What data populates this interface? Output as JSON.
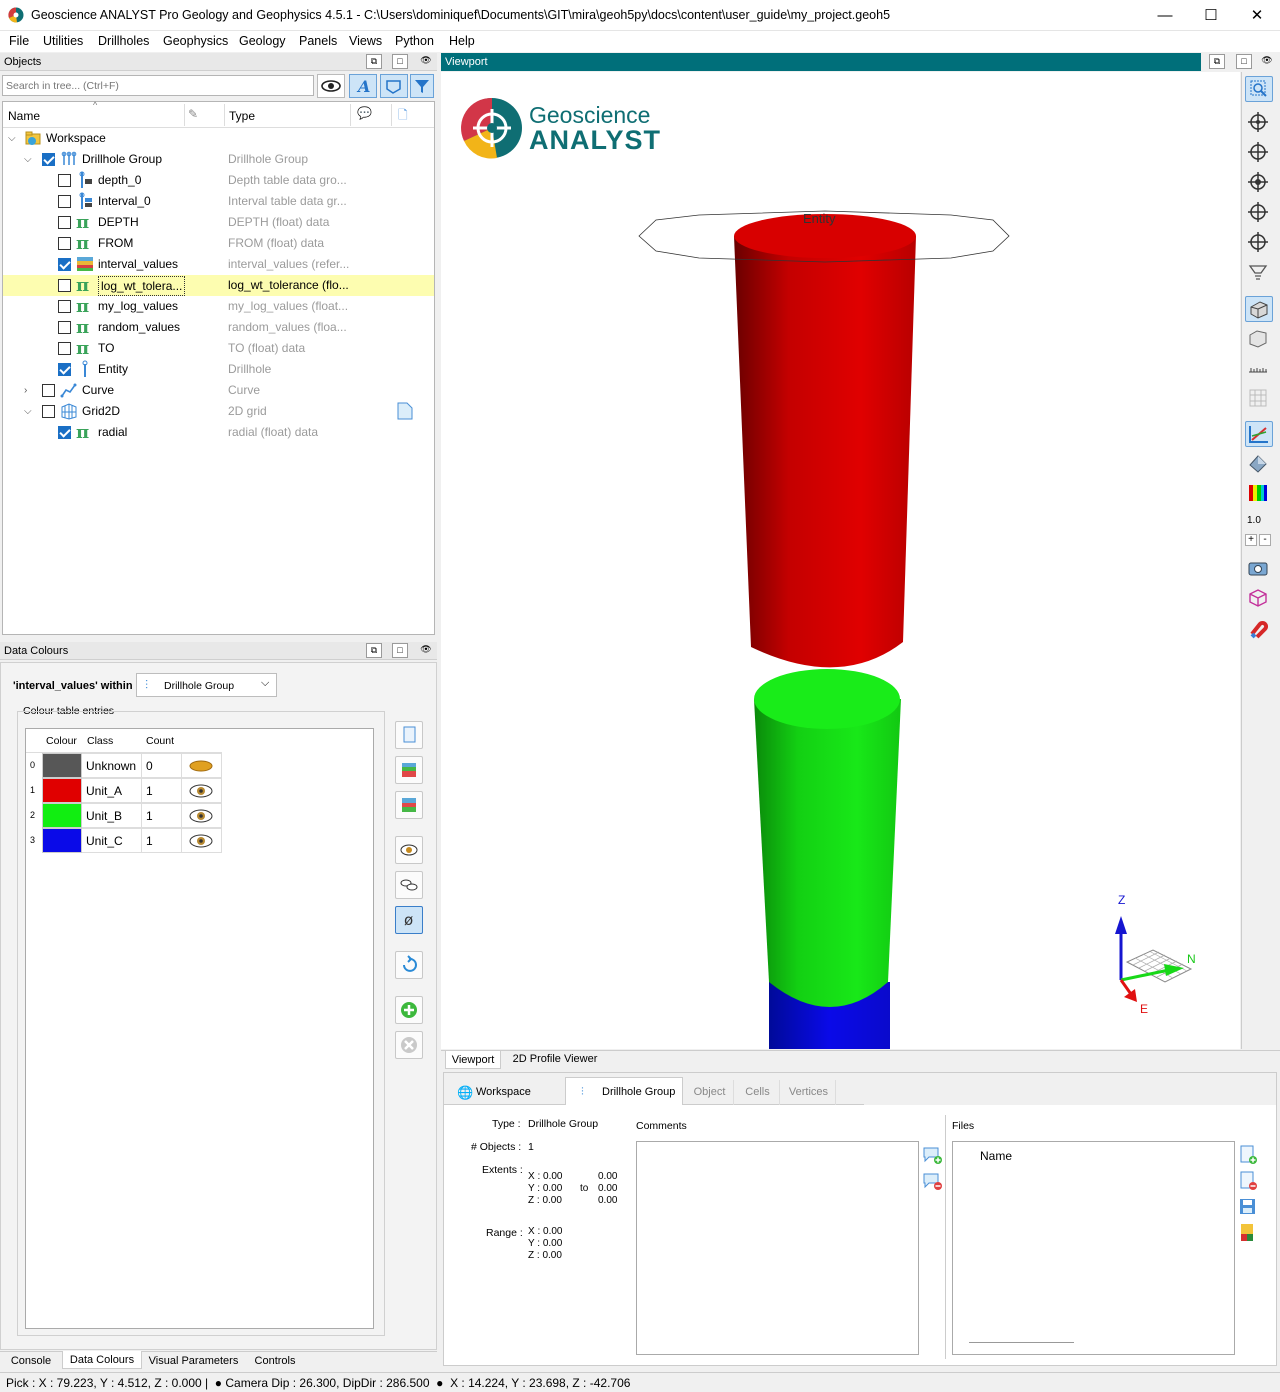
{
  "window": {
    "title": "Geoscience ANALYST Pro Geology and Geophysics 4.5.1 - C:\\Users\\dominiquef\\Documents\\GIT\\mira\\geoh5py\\docs\\content\\user_guide\\my_project.geoh5",
    "minimize": "—",
    "maximize": "☐",
    "close": "✕"
  },
  "menu": [
    "File",
    "Utilities",
    "Drillholes",
    "Geophysics",
    "Geology",
    "Panels",
    "Views",
    "Python",
    "Help"
  ],
  "objects_panel": {
    "title": "Objects",
    "search_placeholder": "Search in tree... (Ctrl+F)",
    "col_name": "Name",
    "col_type": "Type"
  },
  "tree": [
    {
      "label": "Workspace",
      "type": "",
      "level": 0,
      "expand": "open",
      "checkbox": "none",
      "icon": "workspace"
    },
    {
      "label": "Drillhole Group",
      "type": "Drillhole Group",
      "level": 1,
      "expand": "open",
      "checkbox": "on",
      "icon": "drillgroup"
    },
    {
      "label": "depth_0",
      "type": "Depth table data gro...",
      "level": 2,
      "expand": "",
      "checkbox": "off",
      "icon": "depthtable"
    },
    {
      "label": "Interval_0",
      "type": "Interval table data gr...",
      "level": 2,
      "expand": "",
      "checkbox": "off",
      "icon": "intervaltable"
    },
    {
      "label": "DEPTH",
      "type": "DEPTH (float) data",
      "level": 2,
      "expand": "",
      "checkbox": "off",
      "icon": "pi"
    },
    {
      "label": "FROM",
      "type": "FROM (float) data",
      "level": 2,
      "expand": "",
      "checkbox": "off",
      "icon": "pi"
    },
    {
      "label": "interval_values",
      "type": "interval_values (refer...",
      "level": 2,
      "expand": "",
      "checkbox": "on",
      "icon": "ref"
    },
    {
      "label": "log_wt_tolera...",
      "type": "log_wt_tolerance (flo...",
      "level": 2,
      "expand": "",
      "checkbox": "off",
      "icon": "pi",
      "selected": true
    },
    {
      "label": "my_log_values",
      "type": "my_log_values (float...",
      "level": 2,
      "expand": "",
      "checkbox": "off",
      "icon": "pi"
    },
    {
      "label": "random_values",
      "type": "random_values (floa...",
      "level": 2,
      "expand": "",
      "checkbox": "off",
      "icon": "pi"
    },
    {
      "label": "TO",
      "type": "TO (float) data",
      "level": 2,
      "expand": "",
      "checkbox": "off",
      "icon": "pi"
    },
    {
      "label": "Entity",
      "type": "Drillhole",
      "level": 2,
      "expand": "",
      "checkbox": "on",
      "icon": "drillhole"
    },
    {
      "label": "Curve",
      "type": "Curve",
      "level": 1,
      "expand": "closed",
      "checkbox": "off",
      "icon": "curve"
    },
    {
      "label": "Grid2D",
      "type": "2D grid",
      "level": 1,
      "expand": "open",
      "checkbox": "off",
      "icon": "grid"
    },
    {
      "label": "radial",
      "type": "radial (float) data",
      "level": 2,
      "expand": "",
      "checkbox": "on",
      "icon": "pi"
    }
  ],
  "data_colours": {
    "title": "Data Colours",
    "within_label": "'interval_values' within",
    "group": "Drillhole Group",
    "entries_label": "Colour table entries",
    "headers": [
      "Colour",
      "Class",
      "Count"
    ],
    "rows": [
      {
        "idx": "0",
        "class": "Unknown",
        "count": "0",
        "color": "#575757"
      },
      {
        "idx": "1",
        "class": "Unit_A",
        "count": "1",
        "color": "#e00000"
      },
      {
        "idx": "2",
        "class": "Unit_B",
        "count": "1",
        "color": "#11ee11"
      },
      {
        "idx": "3",
        "class": "Unit_C",
        "count": "1",
        "color": "#0a0ae8"
      }
    ]
  },
  "left_tabs": [
    "Console",
    "Data Colours",
    "Visual Parameters",
    "Controls"
  ],
  "viewport": {
    "title": "Viewport",
    "logo_top": "Geoscience",
    "logo_bottom": "ANALYST",
    "entity_label": "Entity",
    "axis_z": "Z",
    "axis_n": "N",
    "axis_e": "E",
    "zoom": "1.0"
  },
  "viewport_tabs": [
    "Viewport",
    "2D Profile Viewer"
  ],
  "info_tabs": [
    "Workspace",
    "Drillhole Group",
    "Object",
    "Cells",
    "Vertices"
  ],
  "info": {
    "type_label": "Type :",
    "type_value": "Drillhole Group",
    "objects_label": "# Objects :",
    "objects_value": "1",
    "extents_label": "Extents :",
    "ext_x": "X : 0.00",
    "ext_y": "Y : 0.00",
    "ext_z": "Z : 0.00",
    "to": "to",
    "ext_x2": "0.00",
    "ext_y2": "0.00",
    "ext_z2": "0.00",
    "range_label": "Range :",
    "range_x": "X : 0.00",
    "range_y": "Y : 0.00",
    "range_z": "Z : 0.00",
    "comments": "Comments",
    "files": "Files",
    "files_col": "Name"
  },
  "status": "Pick : X : 79.223, Y : 4.512, Z : 0.000 |  ● Camera Dip : 26.300, DipDir : 286.500  ●  X : 14.224, Y : 23.698, Z : -42.706",
  "colors": {
    "viewport_header": "#006f7a",
    "highlight": "#fdfdb0",
    "checkbox": "#1a6fc5"
  }
}
